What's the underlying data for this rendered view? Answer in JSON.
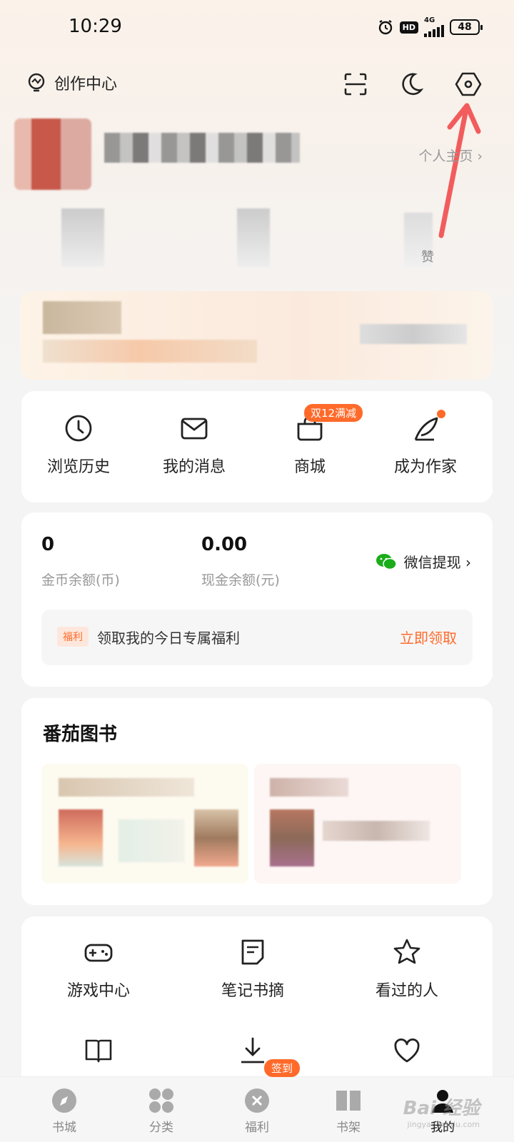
{
  "status_bar": {
    "time": "10:29",
    "hd": "HD",
    "network": "4G",
    "battery": "48"
  },
  "header": {
    "creator_label": "创作中心",
    "scan_icon": "scan-icon",
    "night_icon": "moon-icon",
    "settings_icon": "hexagon-settings-icon"
  },
  "profile": {
    "link": "个人主页 ›",
    "stat_like_label": "赞"
  },
  "quick_actions": [
    {
      "label": "浏览历史",
      "icon": "clock-icon"
    },
    {
      "label": "我的消息",
      "icon": "mail-icon"
    },
    {
      "label": "商城",
      "icon": "shop-bag-icon",
      "badge": "双12满减"
    },
    {
      "label": "成为作家",
      "icon": "quill-icon"
    }
  ],
  "wallet": {
    "coins_value": "0",
    "coins_label": "金币余额(币)",
    "cash_value": "0.00",
    "cash_label": "现金余额(元)",
    "withdraw": "微信提现 ›",
    "welfare_tag": "福利",
    "welfare_text": "领取我的今日专属福利",
    "welfare_button": "立即领取"
  },
  "books": {
    "title": "番茄图书"
  },
  "tools": [
    {
      "label": "游戏中心",
      "icon": "gamepad-icon"
    },
    {
      "label": "笔记书摘",
      "icon": "note-icon"
    },
    {
      "label": "看过的人",
      "icon": "star-icon"
    },
    {
      "label": "",
      "icon": "book-icon"
    },
    {
      "label": "",
      "icon": "download-icon"
    },
    {
      "label": "",
      "icon": "heart-icon"
    }
  ],
  "bottom_nav": [
    {
      "label": "书城",
      "icon": "compass-icon"
    },
    {
      "label": "分类",
      "icon": "category-icon"
    },
    {
      "label": "福利",
      "icon": "gift-icon",
      "badge": "签到"
    },
    {
      "label": "书架",
      "icon": "bookshelf-icon"
    },
    {
      "label": "我的",
      "icon": "profile-icon",
      "active": true
    }
  ],
  "watermark": {
    "text": "Bai 经验",
    "sub": "jingyan.baidu.com"
  },
  "colors": {
    "accent": "#ff6a2a",
    "arrow": "#f25c5c",
    "wechat": "#1aad19"
  }
}
